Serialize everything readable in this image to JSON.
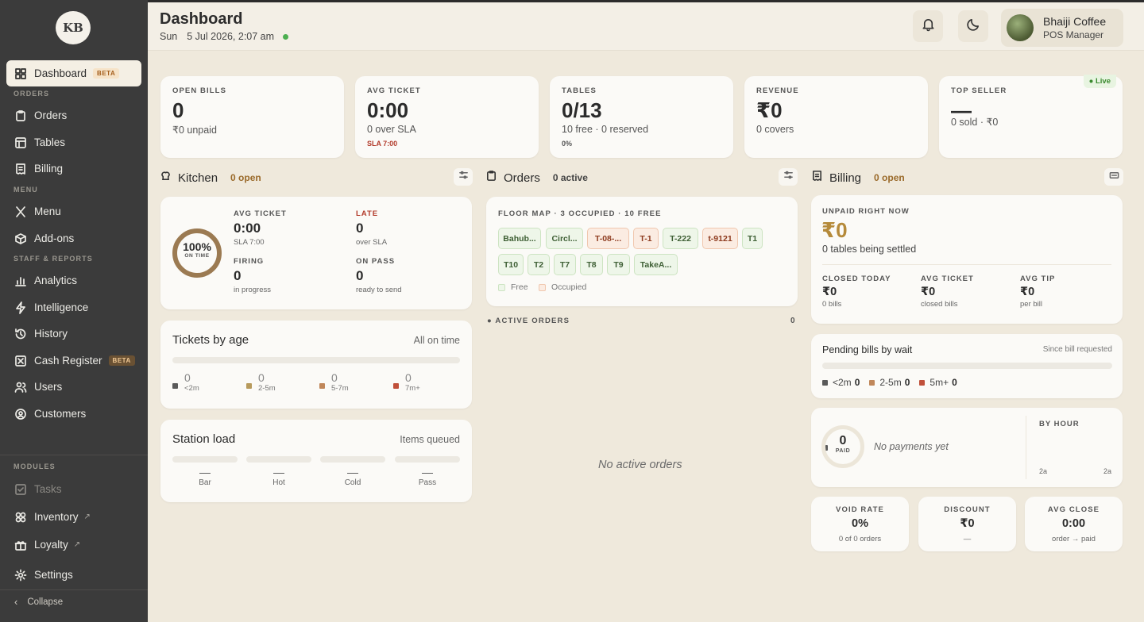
{
  "sidebar": {
    "logo_text": "KB",
    "sections": {
      "orders": "ORDERS",
      "menu": "MENU",
      "staff": "STAFF & REPORTS",
      "modules": "MODULES"
    },
    "items": {
      "dashboard": {
        "label": "Dashboard",
        "badge": "BETA",
        "icon": "dashboard-grid-icon"
      },
      "orders": {
        "label": "Orders",
        "icon": "clipboard-icon"
      },
      "tables": {
        "label": "Tables",
        "icon": "table-grid-icon"
      },
      "billing": {
        "label": "Billing",
        "icon": "receipt-icon"
      },
      "menu": {
        "label": "Menu",
        "icon": "utensils-icon"
      },
      "addons": {
        "label": "Add-ons",
        "icon": "package-icon"
      },
      "analytics": {
        "label": "Analytics",
        "icon": "bar-chart-icon"
      },
      "intelligence": {
        "label": "Intelligence",
        "icon": "bolt-icon"
      },
      "history": {
        "label": "History",
        "icon": "history-icon"
      },
      "cash_register": {
        "label": "Cash Register",
        "badge": "BETA",
        "icon": "cash-register-icon"
      },
      "users": {
        "label": "Users",
        "icon": "users-icon"
      },
      "customers": {
        "label": "Customers",
        "icon": "customer-icon"
      },
      "tasks": {
        "label": "Tasks",
        "icon": "task-check-icon"
      },
      "inventory": {
        "label": "Inventory",
        "ext": "↗",
        "icon": "inventory-icon"
      },
      "loyalty": {
        "label": "Loyalty",
        "ext": "↗",
        "icon": "gift-icon"
      },
      "settings": {
        "label": "Settings",
        "icon": "gear-icon"
      }
    },
    "collapse": "Collapse"
  },
  "header": {
    "title": "Dashboard",
    "day": "Sun",
    "date": "5 Jul 2026, 2:07 am",
    "profile_name": "Bhaiji Coffee",
    "profile_role": "POS Manager"
  },
  "kpis": {
    "open_bills": {
      "label": "OPEN BILLS",
      "value": "0",
      "sub": "₹0 unpaid"
    },
    "avg_ticket": {
      "label": "AVG TICKET",
      "value": "0:00",
      "sub": "0 over SLA",
      "sub2": "SLA 7:00"
    },
    "tables": {
      "label": "TABLES",
      "value": "0/13",
      "sub": "10 free · 0 reserved",
      "sub2": "0%"
    },
    "revenue": {
      "label": "REVENUE",
      "value": "₹0",
      "sub": "0 covers"
    },
    "top_seller": {
      "label": "TOP SELLER",
      "value": "—",
      "sub": "0 sold · ₹0",
      "live": "● Live"
    }
  },
  "kitchen": {
    "title": "Kitchen",
    "count": "0 open",
    "ring_value": "100%",
    "ring_label": "ON TIME",
    "avg_ticket_label": "AVG TICKET",
    "avg_ticket_value": "0:00",
    "avg_ticket_sub": "SLA 7:00",
    "late_label": "LATE",
    "late_value": "0",
    "late_sub": "over SLA",
    "firing_label": "FIRING",
    "firing_value": "0",
    "firing_sub": "in progress",
    "onpass_label": "ON PASS",
    "onpass_value": "0",
    "onpass_sub": "ready to send"
  },
  "tickets_by_age": {
    "title": "Tickets by age",
    "status": "All on time",
    "buckets": [
      {
        "count": "0",
        "label": "<2m",
        "color": "#5a5a5a"
      },
      {
        "count": "0",
        "label": "2-5m",
        "color": "#b79a5c"
      },
      {
        "count": "0",
        "label": "5-7m",
        "color": "#c0875a"
      },
      {
        "count": "0",
        "label": "7m+",
        "color": "#c0503a"
      }
    ]
  },
  "station_load": {
    "title": "Station load",
    "status": "Items queued",
    "stations": [
      {
        "value": "—",
        "name": "Bar"
      },
      {
        "value": "—",
        "name": "Hot"
      },
      {
        "value": "—",
        "name": "Cold"
      },
      {
        "value": "—",
        "name": "Pass"
      }
    ]
  },
  "orders": {
    "title": "Orders",
    "count": "0 active",
    "floor_label": "FLOOR MAP · 3 OCCUPIED · 10 FREE",
    "tables_row1": [
      {
        "name": "Bahub...",
        "state": "free"
      },
      {
        "name": "Circl...",
        "state": "free"
      },
      {
        "name": "T-08-...",
        "state": "occupied"
      },
      {
        "name": "T-1",
        "state": "occupied"
      },
      {
        "name": "T-222",
        "state": "free"
      },
      {
        "name": "t-9121",
        "state": "occupied"
      },
      {
        "name": "T1",
        "state": "free"
      }
    ],
    "tables_row2": [
      {
        "name": "T10",
        "state": "free"
      },
      {
        "name": "T2",
        "state": "free"
      },
      {
        "name": "T7",
        "state": "free"
      },
      {
        "name": "T8",
        "state": "free"
      },
      {
        "name": "T9",
        "state": "free"
      },
      {
        "name": "TakeA...",
        "state": "free"
      }
    ],
    "legend_free": "Free",
    "legend_occupied": "Occupied",
    "active_label": "● ACTIVE ORDERS",
    "active_count": "0",
    "empty": "No active orders"
  },
  "billing": {
    "title": "Billing",
    "count": "0 open",
    "unpaid_label": "UNPAID RIGHT NOW",
    "unpaid_value": "₹0",
    "unpaid_sub": "0 tables being settled",
    "closed_label": "CLOSED TODAY",
    "closed_value": "₹0",
    "closed_sub": "0 bills",
    "avgticket_label": "AVG TICKET",
    "avgticket_value": "₹0",
    "avgticket_sub": "closed bills",
    "avgtip_label": "AVG TIP",
    "avgtip_value": "₹0",
    "avgtip_sub": "per bill",
    "pending_title": "Pending bills by wait",
    "pending_note": "Since bill requested",
    "pending": [
      {
        "label": "<2m",
        "count": "0",
        "color": "#5a5a5a"
      },
      {
        "label": "2-5m",
        "count": "0",
        "color": "#c0875a"
      },
      {
        "label": "5m+",
        "count": "0",
        "color": "#c0503a"
      }
    ],
    "paid_value": "0",
    "paid_label": "PAID",
    "no_payments": "No payments yet",
    "by_hour_label": "BY HOUR",
    "hour_start": "2a",
    "hour_end": "2a",
    "void_label": "VOID RATE",
    "void_value": "0%",
    "void_sub": "0 of 0 orders",
    "discount_label": "DISCOUNT",
    "discount_value": "₹0",
    "discount_sub": "—",
    "avgclose_label": "AVG CLOSE",
    "avgclose_value": "0:00",
    "avgclose_sub": "order → paid"
  }
}
